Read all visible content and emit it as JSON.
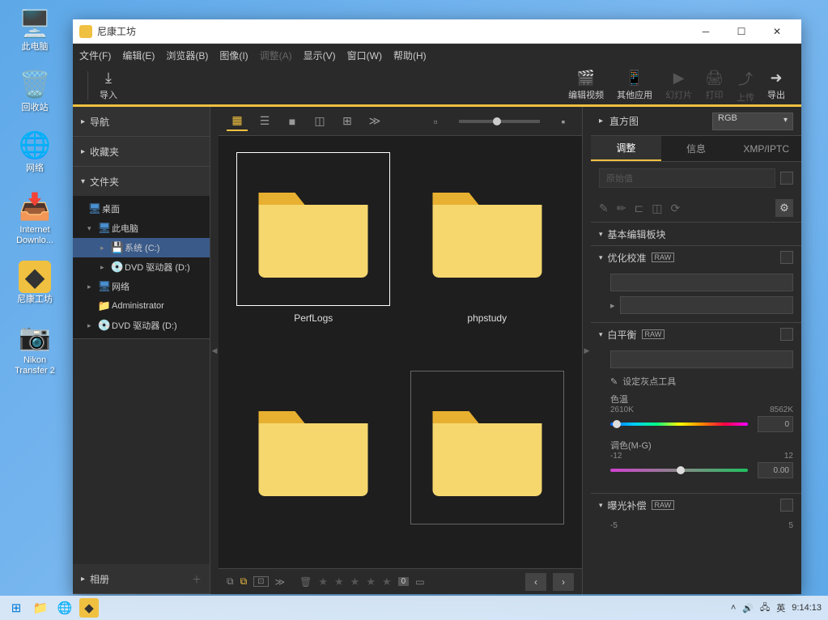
{
  "desktop": {
    "icons": [
      {
        "label": "此电脑",
        "glyph": "🖥️"
      },
      {
        "label": "回收站",
        "glyph": "🗑️"
      },
      {
        "label": "网络",
        "glyph": "🌐"
      },
      {
        "label": "Internet Downlo...",
        "glyph": "📥"
      },
      {
        "label": "尼康工坊",
        "glyph": "◆"
      },
      {
        "label": "Nikon Transfer 2",
        "glyph": "📷"
      }
    ]
  },
  "app": {
    "title": "尼康工坊",
    "menu": [
      "文件(F)",
      "编辑(E)",
      "浏览器(B)",
      "图像(I)",
      "调整(A)",
      "显示(V)",
      "窗口(W)",
      "帮助(H)"
    ],
    "menu_disabled_index": 4,
    "toolbar": {
      "import": "导入",
      "right": [
        {
          "glyph": "🎬",
          "label": "编辑视频"
        },
        {
          "glyph": "📱",
          "label": "其他应用"
        },
        {
          "glyph": "▶",
          "label": "幻灯片"
        },
        {
          "glyph": "🖨",
          "label": "打印"
        },
        {
          "glyph": "⤴",
          "label": "上传"
        },
        {
          "glyph": "➜",
          "label": "导出"
        }
      ]
    }
  },
  "sidebar": {
    "sections": {
      "nav": "导航",
      "favorites": "收藏夹",
      "folders": "文件夹",
      "albums": "相册"
    },
    "tree": [
      {
        "label": "桌面",
        "glyph": "🖥",
        "depth": 0,
        "expand": "",
        "color": "#4a90d0"
      },
      {
        "label": "此电脑",
        "glyph": "🖥",
        "depth": 1,
        "expand": "▾",
        "color": "#4a90d0"
      },
      {
        "label": "系统 (C:)",
        "glyph": "💾",
        "depth": 2,
        "expand": "▸",
        "selected": true
      },
      {
        "label": "DVD 驱动器 (D:)",
        "glyph": "💿",
        "depth": 2,
        "expand": "▸"
      },
      {
        "label": "网络",
        "glyph": "🖥",
        "depth": 1,
        "expand": "▸",
        "color": "#4a90d0"
      },
      {
        "label": "Administrator",
        "glyph": "📁",
        "depth": 1,
        "expand": "",
        "color": "#e8b030"
      },
      {
        "label": "DVD 驱动器 (D:)",
        "glyph": "💿",
        "depth": 1,
        "expand": "▸"
      }
    ]
  },
  "browser": {
    "folders": [
      {
        "name": "PerfLogs",
        "selected": true
      },
      {
        "name": "phpstudy",
        "selected": false
      },
      {
        "name": "",
        "selected": false
      },
      {
        "name": "",
        "selected": false
      }
    ],
    "rating_count": "0"
  },
  "right": {
    "histogram": "直方图",
    "colorspace": "RGB",
    "tabs": [
      "调整",
      "信息",
      "XMP/IPTC"
    ],
    "active_tab": 0,
    "original_value": "原始值",
    "basic_edit": "基本编辑板块",
    "sections": {
      "opt_cal": {
        "title": "优化校准"
      },
      "wb": {
        "title": "白平衡",
        "gray_point": "设定灰点工具",
        "temp_label": "色温",
        "temp_min": "2610K",
        "temp_max": "8562K",
        "temp_value": "0",
        "tint_label": "调色(M-G)",
        "tint_min": "-12",
        "tint_max": "12",
        "tint_value": "0.00"
      },
      "exp": {
        "title": "曝光补偿",
        "min": "-5",
        "max": "5"
      }
    }
  },
  "taskbar": {
    "ime": "英",
    "time": "9:14:13"
  }
}
